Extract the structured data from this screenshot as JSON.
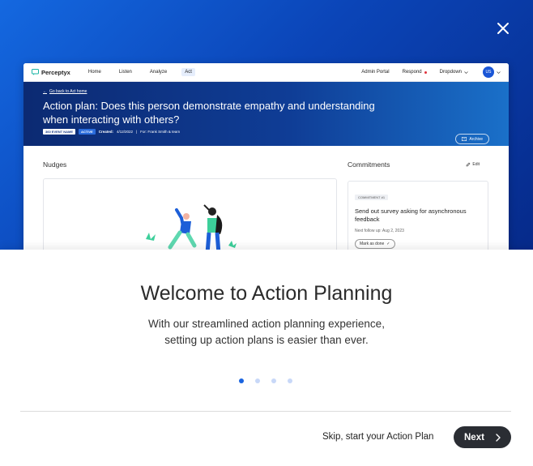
{
  "preview": {
    "brand": "Perceptyx",
    "nav": [
      "Home",
      "Listen",
      "Analyze",
      "Act"
    ],
    "admin_portal": "Admin Portal",
    "respond": "Respond",
    "dropdown": "Dropdown",
    "avatar_initials": "US",
    "back_link": "Go back to Act home",
    "plan_title": "Action plan: Does this person demonstrate empathy and understanding when interacting with others?",
    "event_tag": "360 EVENT NAME",
    "status_tag": "ACTIVE",
    "created_label": "Created:",
    "created_date": "4/12/2022",
    "for_text": "For: Frank Smith & team",
    "archive": "Archive",
    "nudges_title": "Nudges",
    "commitments_title": "Commitments",
    "edit": "Edit",
    "commitment_tag": "COMMITMENT #1",
    "commitment_text": "Send out survey asking for asynchronous feedback",
    "next_follow_up": "Next follow up: Aug 2, 2023",
    "mark_done": "Mark as done"
  },
  "modal": {
    "title": "Welcome to Action Planning",
    "body_line1": "With our streamlined action planning experience,",
    "body_line2": "setting up action plans is easier than ever.",
    "pagination": {
      "total": 4,
      "current": 1
    },
    "skip": "Skip, start your Action Plan",
    "next": "Next"
  },
  "colors": {
    "accent": "#1a64e0",
    "hero_dark": "#062a8a",
    "button_dark": "#2a2d33"
  }
}
